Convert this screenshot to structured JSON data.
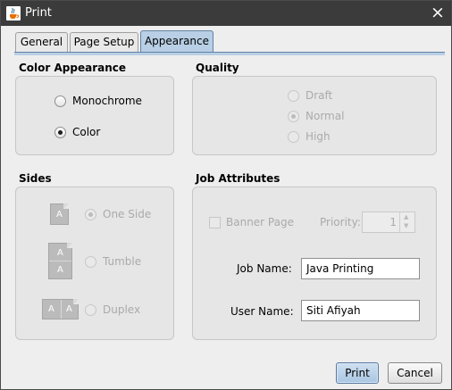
{
  "window": {
    "title": "Print",
    "title_icon": "java-cup-icon",
    "close_icon": "×"
  },
  "tabs": [
    {
      "label": "General",
      "active": false
    },
    {
      "label": "Page Setup",
      "active": false
    },
    {
      "label": "Appearance",
      "active": true
    }
  ],
  "color_appearance": {
    "title": "Color Appearance",
    "options": [
      {
        "label": "Monochrome",
        "selected": false
      },
      {
        "label": "Color",
        "selected": true
      }
    ]
  },
  "quality": {
    "title": "Quality",
    "enabled": false,
    "options": [
      {
        "label": "Draft",
        "selected": false
      },
      {
        "label": "Normal",
        "selected": true
      },
      {
        "label": "High",
        "selected": false
      }
    ]
  },
  "sides": {
    "title": "Sides",
    "enabled": false,
    "page_letter": "A",
    "options": [
      {
        "label": "One Side",
        "selected": true
      },
      {
        "label": "Tumble",
        "selected": false
      },
      {
        "label": "Duplex",
        "selected": false
      }
    ]
  },
  "job_attributes": {
    "title": "Job Attributes",
    "banner_page": {
      "label": "Banner Page",
      "checked": false,
      "enabled": false
    },
    "priority": {
      "label": "Priority:",
      "value": "1",
      "enabled": false
    },
    "job_name": {
      "label": "Job Name:",
      "value": "Java Printing"
    },
    "user_name": {
      "label": "User Name:",
      "value": "Siti Afiyah"
    }
  },
  "buttons": {
    "print": "Print",
    "cancel": "Cancel"
  },
  "colors": {
    "titlebar": "#3b3b3b",
    "active_tab": "#b8cfe5",
    "dialog_bg": "#eeeeee",
    "disabled_text": "#aaaaaa"
  }
}
